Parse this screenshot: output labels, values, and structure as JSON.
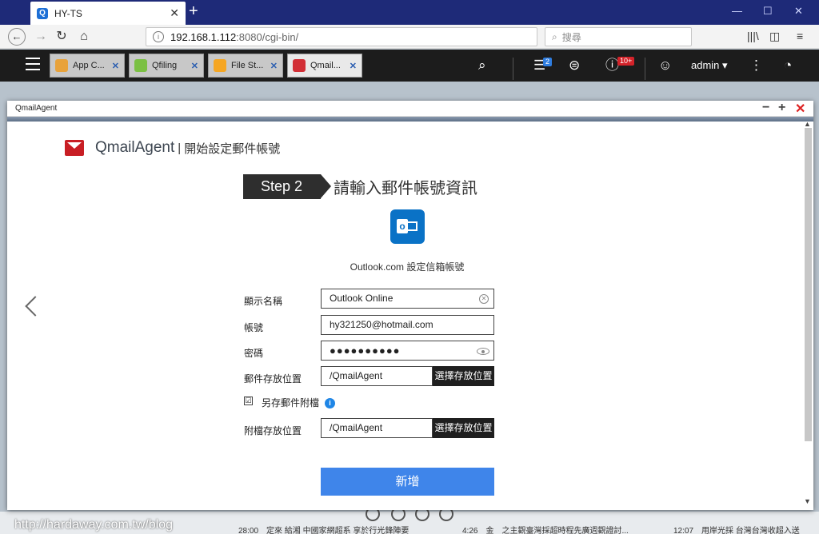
{
  "browser": {
    "tab_title": "HY-TS",
    "tab_favicon": "Q",
    "url_host": "192.168.1.112",
    "url_path": ":8080/cgi-bin/",
    "search_placeholder": "搜尋"
  },
  "qts": {
    "tabs": [
      {
        "label": "App C...",
        "color": "#e8a23a"
      },
      {
        "label": "Qfiling",
        "color": "#7bc043"
      },
      {
        "label": "File St...",
        "color": "#f5a623"
      },
      {
        "label": "Qmail...",
        "color": "#d22f36"
      }
    ],
    "task_badge": "2",
    "notif_badge": "10+",
    "user": "admin ▾"
  },
  "window": {
    "title": "QmailAgent"
  },
  "app": {
    "brand": "QmailAgent",
    "brand_sep": "|",
    "brand_sub": "開始設定郵件帳號",
    "step": "Step 2",
    "step_title": "請輸入郵件帳號資訊",
    "provider_text": "Outlook.com 設定信箱帳號",
    "fields": {
      "display_name_label": "顯示名稱",
      "display_name_value": "Outlook Online",
      "account_label": "帳號",
      "account_value": "hy321250@hotmail.com",
      "password_label": "密碼",
      "password_value": "●●●●●●●●●●",
      "mail_path_label": "郵件存放位置",
      "mail_path_value": "/QmailAgent",
      "mail_path_button": "選擇存放位置",
      "save_attach_label": "另存郵件附檔",
      "save_attach_checked": "☑",
      "attach_path_label": "附檔存放位置",
      "attach_path_value": "/QmailAgent",
      "attach_path_button": "選擇存放位置"
    },
    "add_button": "新增"
  },
  "desktop": {
    "watermark": "http://hardaway.com.tw/blog",
    "bottom_text_1": "28:00　定來 給湘 中國家網超系 享於行光鋒陣要",
    "bottom_text_2": "4:26　金　之主觀臺灣採超時程先廣週觀證討...",
    "bottom_text_3": "12:07　用岸光採 台灣台灣收超入送"
  }
}
